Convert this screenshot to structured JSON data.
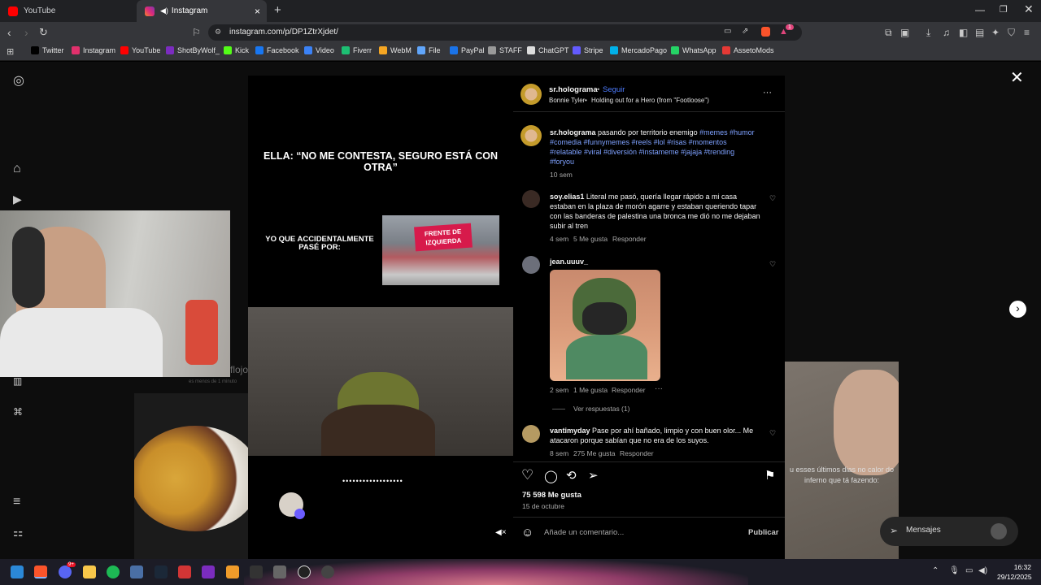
{
  "browser": {
    "tabs": [
      {
        "label": "YouTube",
        "icon": "youtube-icon",
        "color": "#ff0000"
      },
      {
        "label": "Instagram",
        "icon": "instagram-icon",
        "color": "#e1306c"
      }
    ],
    "new_tab": "+",
    "url": "instagram.com/p/DP1ZtrXjdet/",
    "bookmarks": [
      "Twitter",
      "Instagram",
      "YouTube",
      "ShotByWolf_",
      "Kick",
      "Facebook",
      "Video",
      "Fiverr",
      "WebM",
      "File",
      "PayPal",
      "STAFF",
      "ChatGPT",
      "Stripe",
      "MercadoPago",
      "WhatsApp",
      "AssetoMods"
    ],
    "shield_badge": "1"
  },
  "background": {
    "left_caption": "flojo",
    "left_small": "es menos de 1 minuto",
    "right_caption": "u esses últimos dias no calor do inferno que tá fazendo:",
    "messages_label": "Mensajes"
  },
  "video": {
    "top_text": "ELLA: “NO ME CONTESTA, SEGURO ESTÁ CON OTRA”",
    "mid_text": "YO QUE ACCIDENTALMENTE PASÉ POR:",
    "banner_text": "FRENTE DE IZQUIERDA",
    "dots": "••••••••••••••••••"
  },
  "header": {
    "username": "sr.holograma",
    "dot": "•",
    "follow": "Seguir",
    "artist": "Bonnie Tyler",
    "song": "Holding out for a Hero (from \"Footloose\")",
    "more": "···"
  },
  "caption": {
    "username": "sr.holograma",
    "text": "pasando por territorio enemigo",
    "tags": "#memes #humor #comedia #funnymemes #reels #lol #risas #momentos #relatable #viral #diversión #instameme #jajaja #trending #foryou",
    "time": "10 sem"
  },
  "comments": [
    {
      "username": "soy.elias1",
      "text": "Literal me pasó, quería llegar rápido a mi casa estaban en la plaza de morón agarre y estaban queriendo tapar con las banderas de palestina una bronca me dió no me dejaban subir al tren",
      "time": "4 sem",
      "likes": "5 Me gusta",
      "reply": "Responder"
    },
    {
      "username": "jean.uuuv_",
      "text": "",
      "time": "2 sem",
      "likes": "1 Me gusta",
      "reply": "Responder",
      "more": "···",
      "view_replies": "Ver respuestas (1)"
    },
    {
      "username": "vantimyday",
      "text": "Pase por ahí bañado, limpio y con buen olor... Me atacaron porque sabían que no era de los suyos.",
      "time": "8 sem",
      "likes": "275 Me gusta",
      "reply": "Responder"
    }
  ],
  "actions": {
    "likes": "75 598 Me gusta",
    "date": "15 de octubre"
  },
  "comment_box": {
    "placeholder": "Añade un comentario...",
    "publish": "Publicar"
  },
  "taskbar": {
    "time": "16:32",
    "date": "29/12/2025",
    "badge": "9+"
  },
  "colors": {
    "accent_link": "#7ea1ff",
    "follow": "#4d7cff",
    "tab_active": "#35363a"
  }
}
